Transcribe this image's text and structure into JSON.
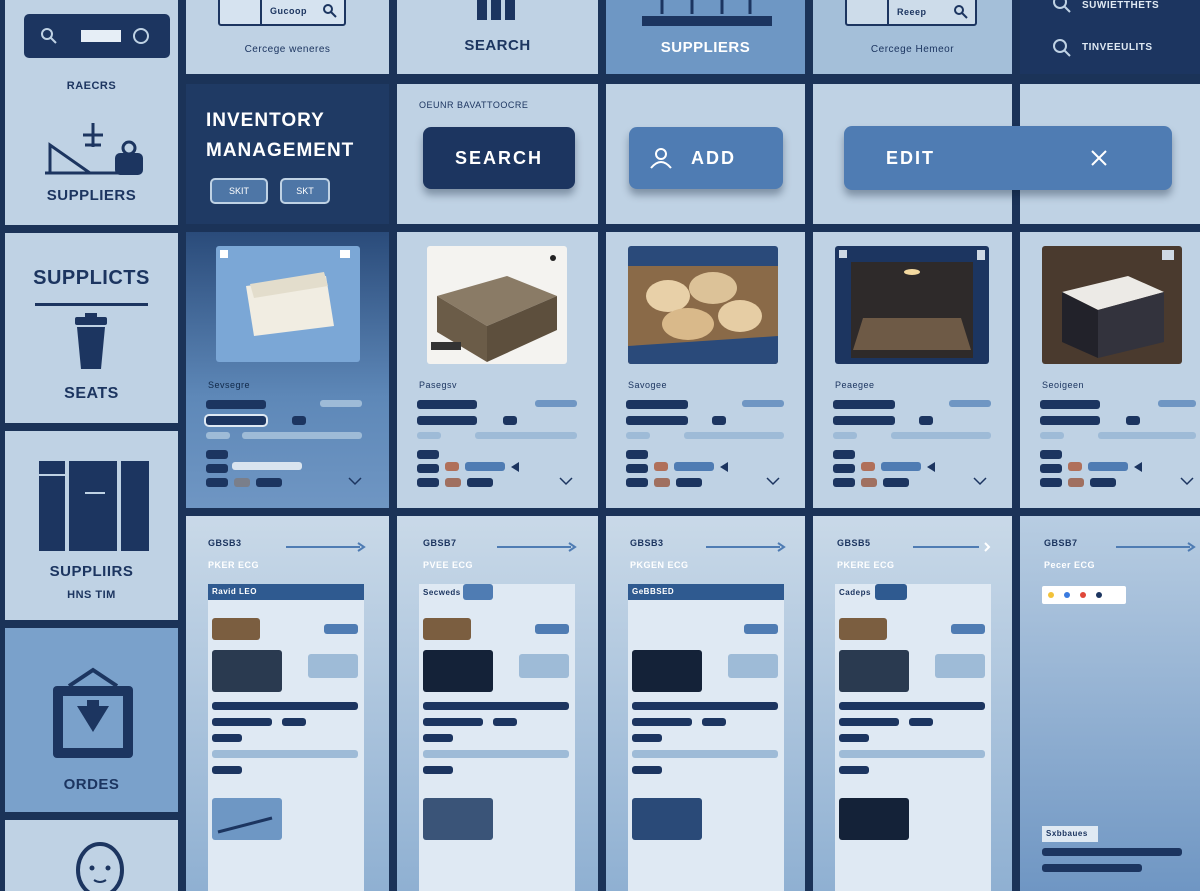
{
  "colors": {
    "navy": "#1c3560",
    "light_tile": "#bfd2e4",
    "mid_blue": "#6e97c4",
    "dark_tile": "#1f3a64"
  },
  "nav": {
    "top_label": "RAECRS",
    "suppliers_1": "SUPPLIERS",
    "supplicts": "SUPPLICTS",
    "seats": "SEATS",
    "suppliers_2": "SUPPLIIRS",
    "suppliers_2_sub": "HNS TIM",
    "orders": "ORDES"
  },
  "top_row": {
    "search_caption": "Cercege weneres",
    "search_tile_label": "SEARCH",
    "suppliers_tile_label": "SUPPLIERS",
    "search_box_text": "Reeep",
    "search_box2_caption": "Cercege Hemeor",
    "right_item_1": "SUWIETTHETS",
    "right_item_2": "TINVEEULITS"
  },
  "header": {
    "title_line1": "INVENTORY",
    "title_line2": "MANAGEMENT",
    "pill_1": "SKIT",
    "pill_2": "SKT",
    "caption": "OEUNR BAVATTOOCRE",
    "search_button": "SEARCH",
    "add_button": "ADD",
    "edit_button": "EDIT"
  },
  "products": [
    {
      "name": "Sevsegre",
      "photo": "folder"
    },
    {
      "name": "Pasegsv",
      "photo": "box"
    },
    {
      "name": "Savogee",
      "photo": "stones"
    },
    {
      "name": "Peaegee",
      "photo": "shelf"
    },
    {
      "name": "Seoigeen",
      "photo": "crate"
    }
  ],
  "detail_cards": [
    {
      "code": "GBSB3",
      "title": "PKER ECG",
      "list_header": "Ravid LEO"
    },
    {
      "code": "GBSB7",
      "title": "PVEE ECG",
      "list_header": "Secweds"
    },
    {
      "code": "GBSB3",
      "title": "PKGEN ECG",
      "list_header": "GeBBSED"
    },
    {
      "code": "GBSB5",
      "title": "PKERE ECG",
      "list_header": "Cadeps"
    },
    {
      "code": "GBSB7",
      "title": "Pecer ECG",
      "list_header": "",
      "footer_tag": "Sxbbaues"
    }
  ]
}
